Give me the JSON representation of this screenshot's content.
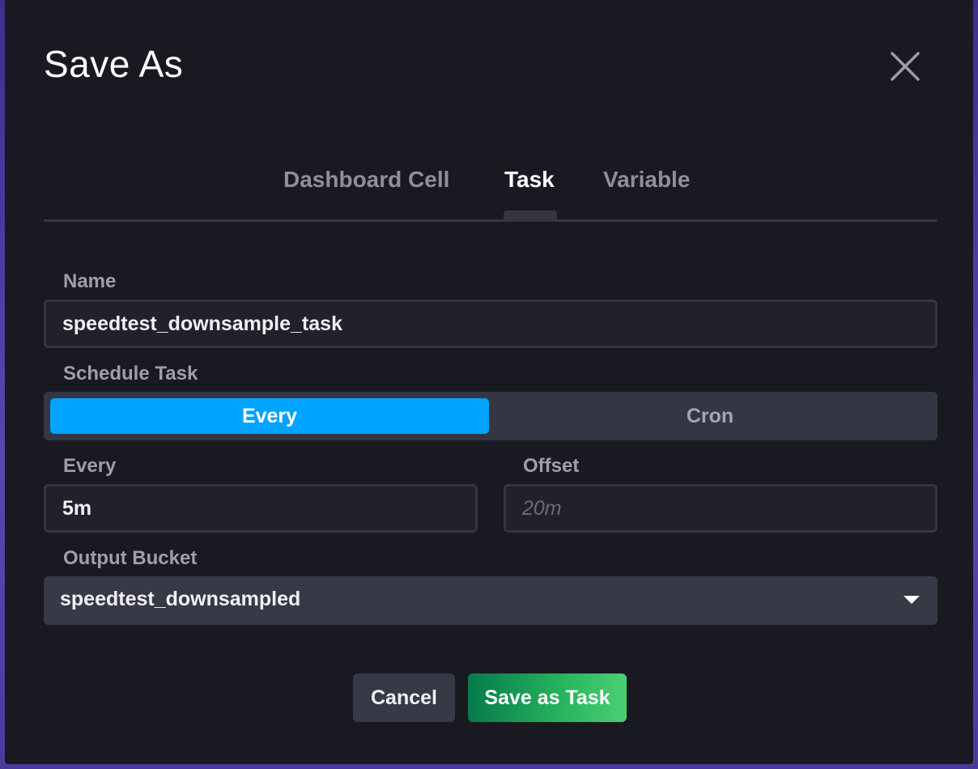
{
  "dialog": {
    "title": "Save As",
    "close_icon": "close-icon"
  },
  "tabs": [
    {
      "label": "Dashboard Cell",
      "active": false
    },
    {
      "label": "Task",
      "active": true
    },
    {
      "label": "Variable",
      "active": false
    }
  ],
  "form": {
    "name_label": "Name",
    "name_value": "speedtest_downsample_task",
    "schedule_label": "Schedule Task",
    "schedule_options": [
      {
        "label": "Every",
        "selected": true
      },
      {
        "label": "Cron",
        "selected": false
      }
    ],
    "every_label": "Every",
    "every_value": "5m",
    "offset_label": "Offset",
    "offset_placeholder": "20m",
    "output_bucket_label": "Output Bucket",
    "output_bucket_value": "speedtest_downsampled"
  },
  "buttons": {
    "cancel_label": "Cancel",
    "save_label": "Save as Task"
  },
  "colors": {
    "accent_blue": "#00a3ff",
    "save_green": "#27b55e",
    "dialog_bg": "#191a21"
  }
}
